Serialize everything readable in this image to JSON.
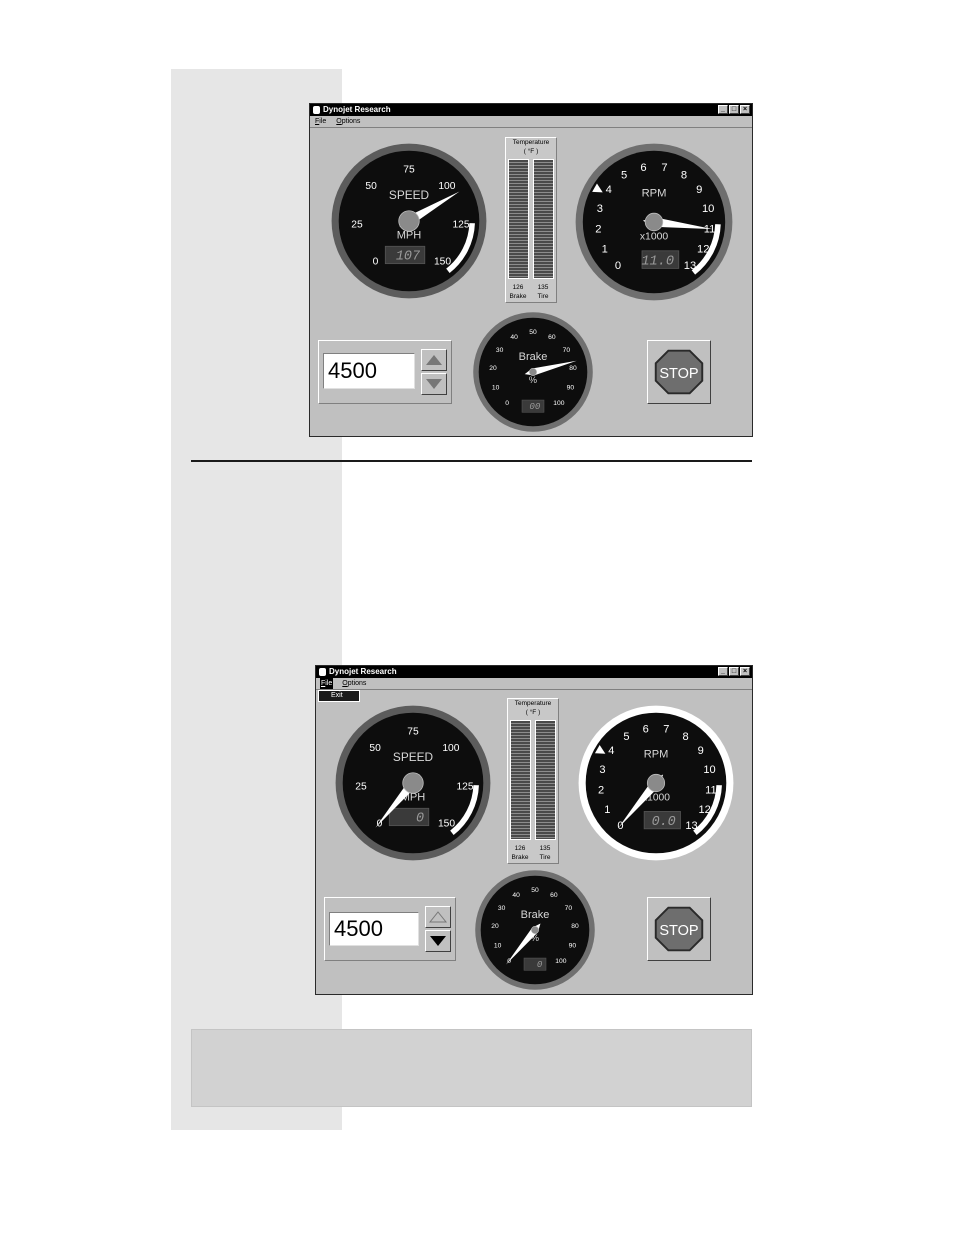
{
  "window": {
    "title": "Dynojet Research",
    "menu": [
      {
        "key": "F",
        "rest": "ile"
      },
      {
        "key": "O",
        "rest": "ptions"
      }
    ],
    "file_menu_items": [
      "Exit"
    ]
  },
  "speed_gauge": {
    "label": "SPEED",
    "unit": "MPH",
    "ticks": [
      "0",
      "25",
      "50",
      "75",
      "100",
      "125",
      "150"
    ]
  },
  "rpm_gauge": {
    "label": "RPM",
    "unit": "x1000",
    "ticks": [
      "0",
      "1",
      "2",
      "3",
      "4",
      "5",
      "6",
      "7",
      "8",
      "9",
      "10",
      "11",
      "12",
      "13"
    ]
  },
  "brake_gauge": {
    "label": "Brake",
    "unit": "%",
    "ticks": [
      "0",
      "10",
      "20",
      "30",
      "40",
      "50",
      "60",
      "70",
      "80",
      "90",
      "100"
    ]
  },
  "temperature": {
    "title": "Temperature",
    "unit": "( °F )",
    "brake_value": "126",
    "tire_value": "135",
    "brake_label": "Brake",
    "tire_label": "Tire"
  },
  "stop_label": "STOP",
  "screens": [
    {
      "rpm_input": "4500",
      "speed_value": 107,
      "speed_readout": "107",
      "rpm_value": 11.0,
      "rpm_readout": "11.0",
      "brake_value": 77,
      "brake_readout": "00",
      "menu_open": false
    },
    {
      "rpm_input": "4500",
      "speed_value": 0,
      "speed_readout": "0",
      "rpm_value": 0,
      "rpm_readout": "0.0",
      "brake_value": 0,
      "brake_readout": "0",
      "menu_open": true
    }
  ]
}
